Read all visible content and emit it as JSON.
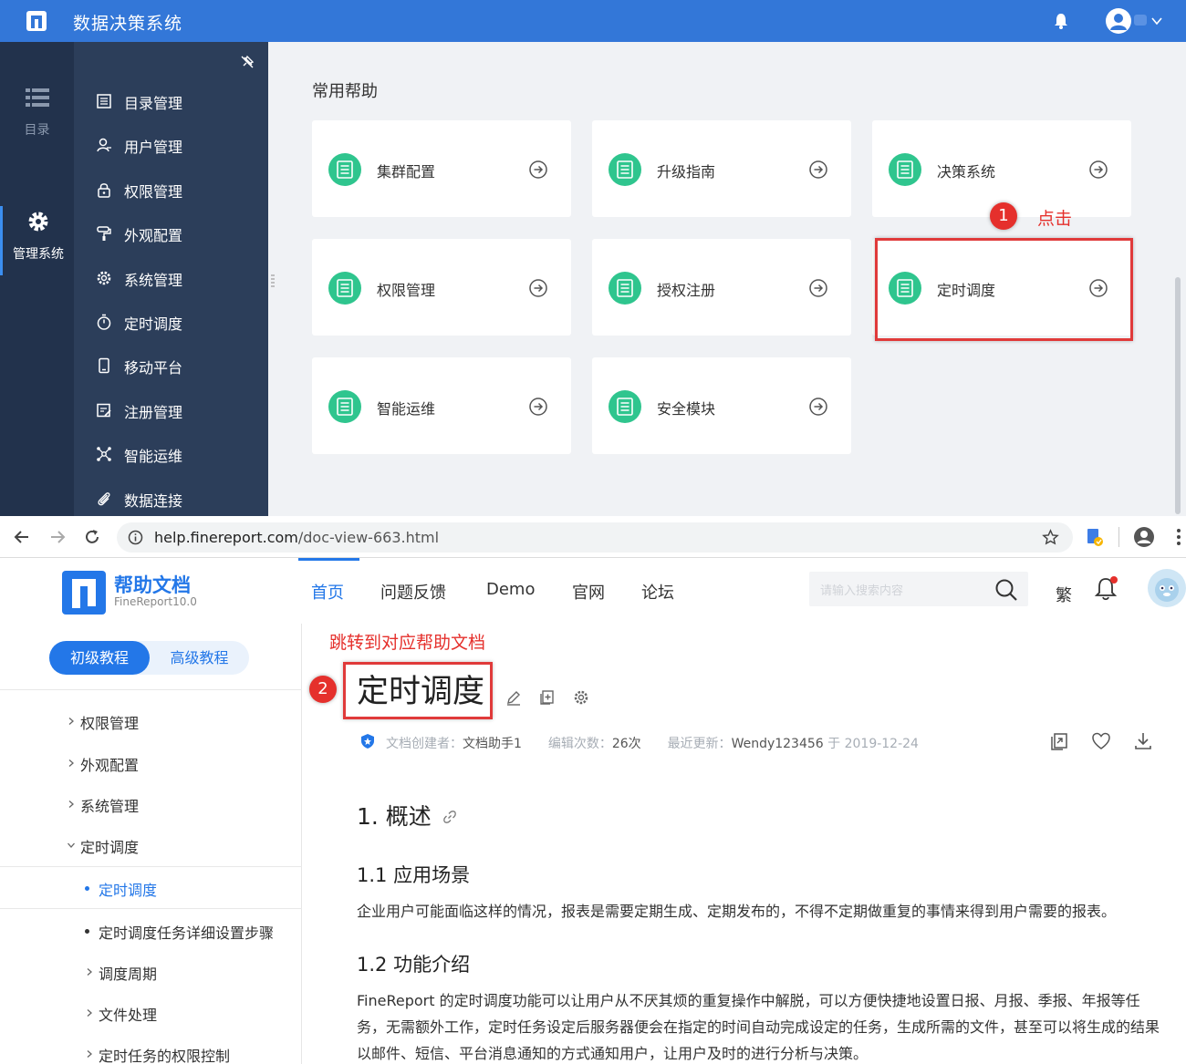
{
  "top_app": {
    "title": "数据决策系统",
    "rail": {
      "catalog_label": "目录",
      "mgmt_label": "管理系统"
    },
    "menu": [
      {
        "label": "目录管理",
        "icon": "list-doc-icon"
      },
      {
        "label": "用户管理",
        "icon": "user-icon"
      },
      {
        "label": "权限管理",
        "icon": "lock-icon"
      },
      {
        "label": "外观配置",
        "icon": "paint-roller-icon"
      },
      {
        "label": "系统管理",
        "icon": "gear-icon"
      },
      {
        "label": "定时调度",
        "icon": "stopwatch-icon"
      },
      {
        "label": "移动平台",
        "icon": "mobile-icon"
      },
      {
        "label": "注册管理",
        "icon": "register-icon"
      },
      {
        "label": "智能运维",
        "icon": "network-icon"
      },
      {
        "label": "数据连接",
        "icon": "paperclip-icon"
      }
    ],
    "content_heading": "常用帮助",
    "cards": [
      {
        "label": "集群配置"
      },
      {
        "label": "升级指南"
      },
      {
        "label": "决策系统"
      },
      {
        "label": "权限管理"
      },
      {
        "label": "授权注册"
      },
      {
        "label": "定时调度"
      },
      {
        "label": "智能运维"
      },
      {
        "label": "安全模块"
      }
    ],
    "step1_number": "1",
    "step1_note": "点击",
    "accent_color": "#3377d8",
    "card_icon_color": "#2fc58e",
    "annotation_color": "#e5302c"
  },
  "browser": {
    "url_host": "help.finereport.com",
    "url_path": "/doc-view-663.html"
  },
  "site": {
    "name": "帮助文档",
    "version": "FineReport10.0",
    "tabs": [
      "首页",
      "问题反馈",
      "Demo",
      "官网",
      "论坛"
    ],
    "search_placeholder": "请输入搜索内容",
    "traditional_label": "繁",
    "accent_color": "#2377e8"
  },
  "sidebar": {
    "tab_beginner": "初级教程",
    "tab_advanced": "高级教程",
    "items": [
      {
        "label": "权限管理"
      },
      {
        "label": "外观配置"
      },
      {
        "label": "系统管理"
      },
      {
        "label": "定时调度"
      }
    ],
    "sub_active": "定时调度",
    "sub_items": [
      {
        "label": "定时调度任务详细设置步骤"
      },
      {
        "label": "调度周期"
      },
      {
        "label": "文件处理"
      },
      {
        "label": "定时任务的权限控制"
      }
    ]
  },
  "doc": {
    "jump_note": "跳转到对应帮助文档",
    "step2_number": "2",
    "title": "定时调度",
    "creator_label": "文档创建者：",
    "creator": "文档助手1",
    "edits_label": "编辑次数：",
    "edits": "26次",
    "updated_label": "最近更新：",
    "updated_by": "Wendy123456",
    "updated_on_label": "于",
    "updated_date": "2019-12-24",
    "section1": "1. 概述",
    "section1_1": "1.1 应用场景",
    "para1": "企业用户可能面临这样的情况，报表是需要定期生成、定期发布的，不得不定期做重复的事情来得到用户需要的报表。",
    "section1_2": "1.2 功能介绍",
    "para2": "FineReport 的定时调度功能可以让用户从不厌其烦的重复操作中解脱，可以方便快捷地设置日报、月报、季报、年报等任务，无需额外工作，定时任务设定后服务器便会在指定的时间自动完成设定的任务，生成所需的文件，甚至可以将生成的结果以邮件、短信、平台消息通知的方式通知用户，让用户及时的进行分析与决策。"
  }
}
